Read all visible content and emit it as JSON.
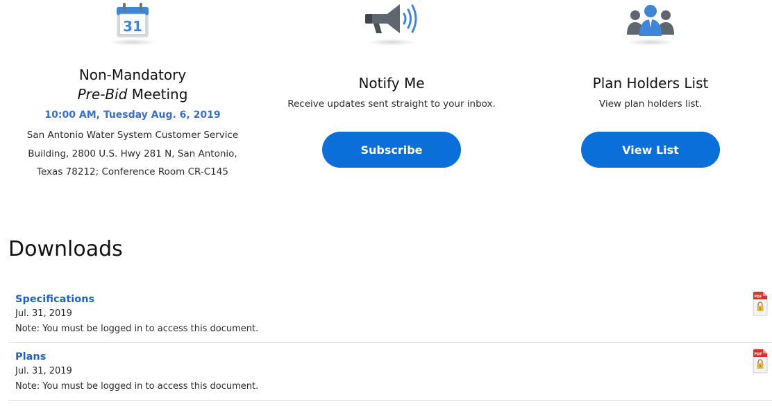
{
  "meeting": {
    "icon": "calendar-icon",
    "calendar_day": "31",
    "title_line1": "Non-Mandatory",
    "title_italic": "Pre-Bid",
    "title_rest": " Meeting",
    "time": "10:00 AM, Tuesday Aug. 6, 2019",
    "address_lines": [
      "San Antonio Water System Customer Service",
      "Building, 2800 U.S. Hwy 281 N, San Antonio,",
      "Texas 78212; Conference Room CR-C145"
    ]
  },
  "notify": {
    "icon": "megaphone-icon",
    "title": "Notify Me",
    "description": "Receive updates sent straight to your inbox.",
    "button_label": "Subscribe"
  },
  "plan_holders": {
    "icon": "people-icon",
    "title": "Plan Holders List",
    "description": "View plan holders list.",
    "button_label": "View List"
  },
  "downloads": {
    "heading": "Downloads",
    "pdf_badge": "PDF",
    "items": [
      {
        "name": "Specifications",
        "date": "Jul. 31, 2019",
        "note": "Note: You must be logged in to access this document.",
        "icon": "locked-pdf-icon"
      },
      {
        "name": "Plans",
        "date": "Jul. 31, 2019",
        "note": "Note: You must be logged in to access this document.",
        "icon": "locked-pdf-icon"
      }
    ]
  },
  "colors": {
    "button_blue": "#0a6fd8",
    "link_blue": "#1f63c6",
    "time_blue": "#3a6fc4",
    "pdf_red": "#d9312b"
  }
}
